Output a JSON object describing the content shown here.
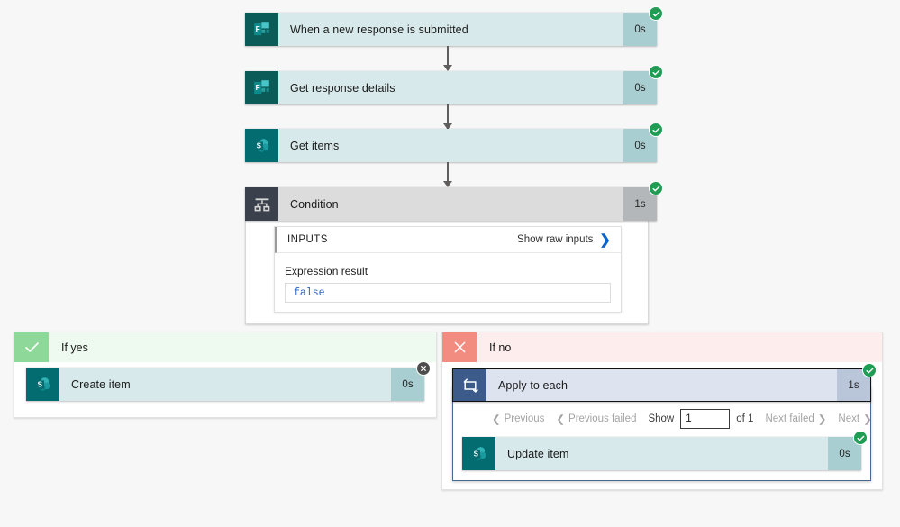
{
  "flow": {
    "steps": [
      {
        "name": "When a new response is submitted",
        "duration": "0s",
        "status": "succeeded",
        "connector": "microsoft-forms"
      },
      {
        "name": "Get response details",
        "duration": "0s",
        "status": "succeeded",
        "connector": "microsoft-forms"
      },
      {
        "name": "Get items",
        "duration": "0s",
        "status": "succeeded",
        "connector": "sharepoint"
      },
      {
        "name": "Condition",
        "duration": "1s",
        "status": "succeeded",
        "connector": "condition"
      }
    ]
  },
  "condition": {
    "inputs_label": "INPUTS",
    "show_raw_inputs": "Show raw inputs",
    "chevron": "❯",
    "expression_result_label": "Expression result",
    "expression_result_value": "false"
  },
  "branches": {
    "yes": {
      "label": "If yes",
      "mark": "check-icon",
      "action": {
        "name": "Create item",
        "duration": "0s",
        "status": "skipped",
        "connector": "sharepoint"
      }
    },
    "no": {
      "label": "If no",
      "mark": "close-icon",
      "action": {
        "name": "Apply to each",
        "duration": "1s",
        "status": "succeeded",
        "connector": "apply-to-each"
      },
      "pagination": {
        "previous": "Previous",
        "previous_failed": "Previous failed",
        "show": "Show",
        "page_value": "1",
        "of_total": "of 1",
        "next_failed": "Next failed",
        "next": "Next",
        "chevron_left": "❮",
        "chevron_right": "❯"
      },
      "inner_action": {
        "name": "Update item",
        "duration": "0s",
        "status": "succeeded",
        "connector": "sharepoint"
      }
    }
  },
  "colors": {
    "background": "#f7f7f7",
    "teal_body": "#d7e9ea",
    "teal_duration": "#a9ced1",
    "gray_body": "#dcdcdc",
    "gray_duration": "#b3b7b9",
    "blue_body": "#dde3ef",
    "blue_duration": "#b9c5d9",
    "success_green": "#1f9d55",
    "skipped_gray": "#4d4d4d",
    "yes_mark": "#8ed99a",
    "yes_body": "#eefaef",
    "no_mark": "#f28b80",
    "no_body": "#fdeeed",
    "link_blue": "#0b63ce",
    "expression_blue": "#2a62c4"
  }
}
